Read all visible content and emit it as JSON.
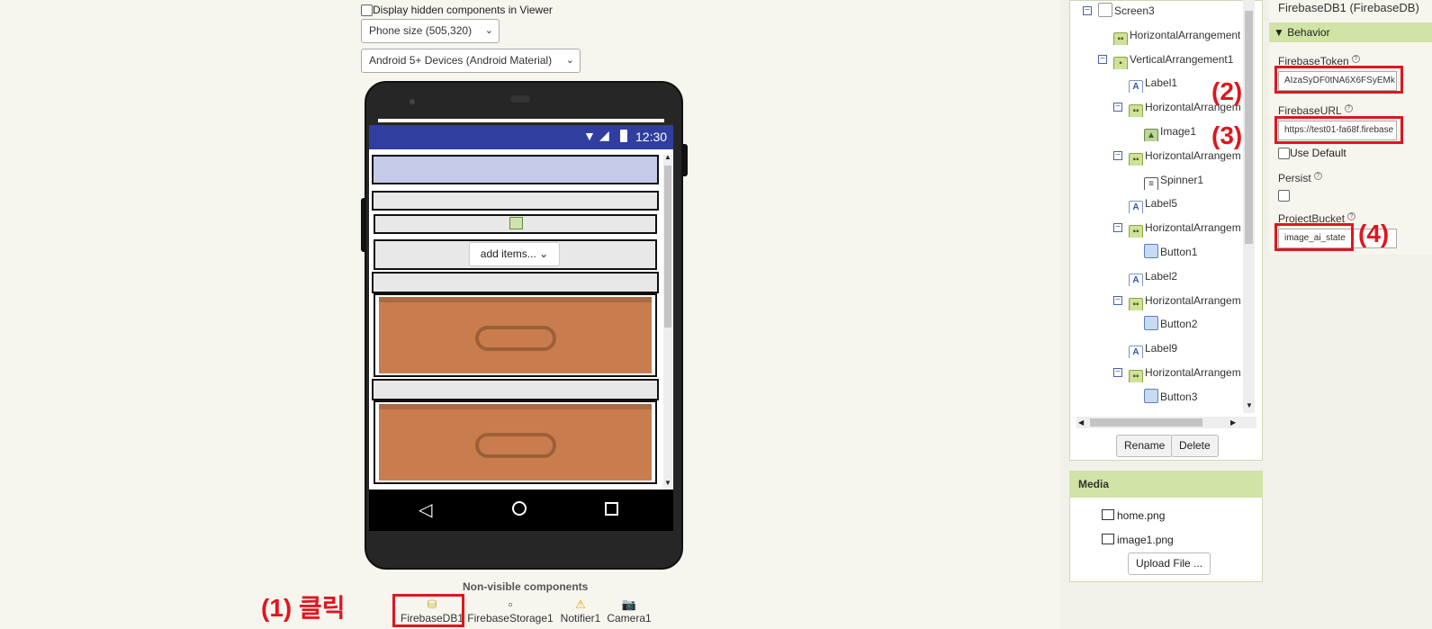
{
  "viewer": {
    "display_hidden_label": "Display hidden components in Viewer",
    "phone_size_select": "Phone size (505,320)",
    "theme_select": "Android 5+ Devices (Android Material)",
    "status_time": "12:30",
    "spinner_text": "add items...",
    "nonvisible_title": "Non-visible components",
    "nonvisible_items": [
      {
        "label": "FirebaseDB1",
        "icon": "firebase-db-icon"
      },
      {
        "label": "FirebaseStorage1",
        "icon": "firebase-storage-icon"
      },
      {
        "label": "Notifier1",
        "icon": "warning-icon"
      },
      {
        "label": "Camera1",
        "icon": "camera-icon"
      }
    ]
  },
  "annotations": {
    "step1": "(1) 클릭",
    "step2": "(2)",
    "step3": "(3)",
    "step4": "(4)"
  },
  "tree": {
    "items": [
      {
        "label": "Screen3",
        "icon": "screen-icon",
        "toggle": "⊟"
      },
      {
        "label": "HorizontalArrangement",
        "icon": "horizontal-arrangement-icon",
        "toggle": ""
      },
      {
        "label": "VerticalArrangement1",
        "icon": "vertical-arrangement-icon",
        "toggle": "⊟"
      },
      {
        "label": "Label1",
        "icon": "label-icon",
        "toggle": ""
      },
      {
        "label": "HorizontalArrangem",
        "icon": "horizontal-arrangement-icon",
        "toggle": "⊟"
      },
      {
        "label": "Image1",
        "icon": "image-icon",
        "toggle": ""
      },
      {
        "label": "HorizontalArrangem",
        "icon": "horizontal-arrangement-icon",
        "toggle": "⊟"
      },
      {
        "label": "Spinner1",
        "icon": "spinner-icon",
        "toggle": ""
      },
      {
        "label": "Label5",
        "icon": "label-icon",
        "toggle": ""
      },
      {
        "label": "HorizontalArrangem",
        "icon": "horizontal-arrangement-icon",
        "toggle": "⊟"
      },
      {
        "label": "Button1",
        "icon": "button-icon",
        "toggle": ""
      },
      {
        "label": "Label2",
        "icon": "label-icon",
        "toggle": ""
      },
      {
        "label": "HorizontalArrangem",
        "icon": "horizontal-arrangement-icon",
        "toggle": "⊟"
      },
      {
        "label": "Button2",
        "icon": "button-icon",
        "toggle": ""
      },
      {
        "label": "Label9",
        "icon": "label-icon",
        "toggle": ""
      },
      {
        "label": "HorizontalArrangem",
        "icon": "horizontal-arrangement-icon",
        "toggle": "⊟"
      },
      {
        "label": "Button3",
        "icon": "button-icon",
        "toggle": ""
      }
    ],
    "rename_label": "Rename",
    "delete_label": "Delete"
  },
  "media": {
    "title": "Media",
    "files": [
      "home.png",
      "image1.png"
    ],
    "upload_label": "Upload File ..."
  },
  "properties": {
    "component_title": "FirebaseDB1 (FirebaseDB)",
    "section": "Behavior",
    "firebase_token_label": "FirebaseToken",
    "firebase_token_value": "AIzaSyDF0tNA6X6FSyEMk",
    "firebase_url_label": "FirebaseURL",
    "firebase_url_value": "https://test01-fa68f.firebase",
    "use_default_label": "Use Default",
    "persist_label": "Persist",
    "project_bucket_label": "ProjectBucket",
    "project_bucket_value": "image_ai_state"
  },
  "colors": {
    "statusbar": "#303f9f",
    "annotation_red": "#e0161e",
    "panel_header": "#d2e3a6",
    "drawer": "#c97d4e"
  }
}
